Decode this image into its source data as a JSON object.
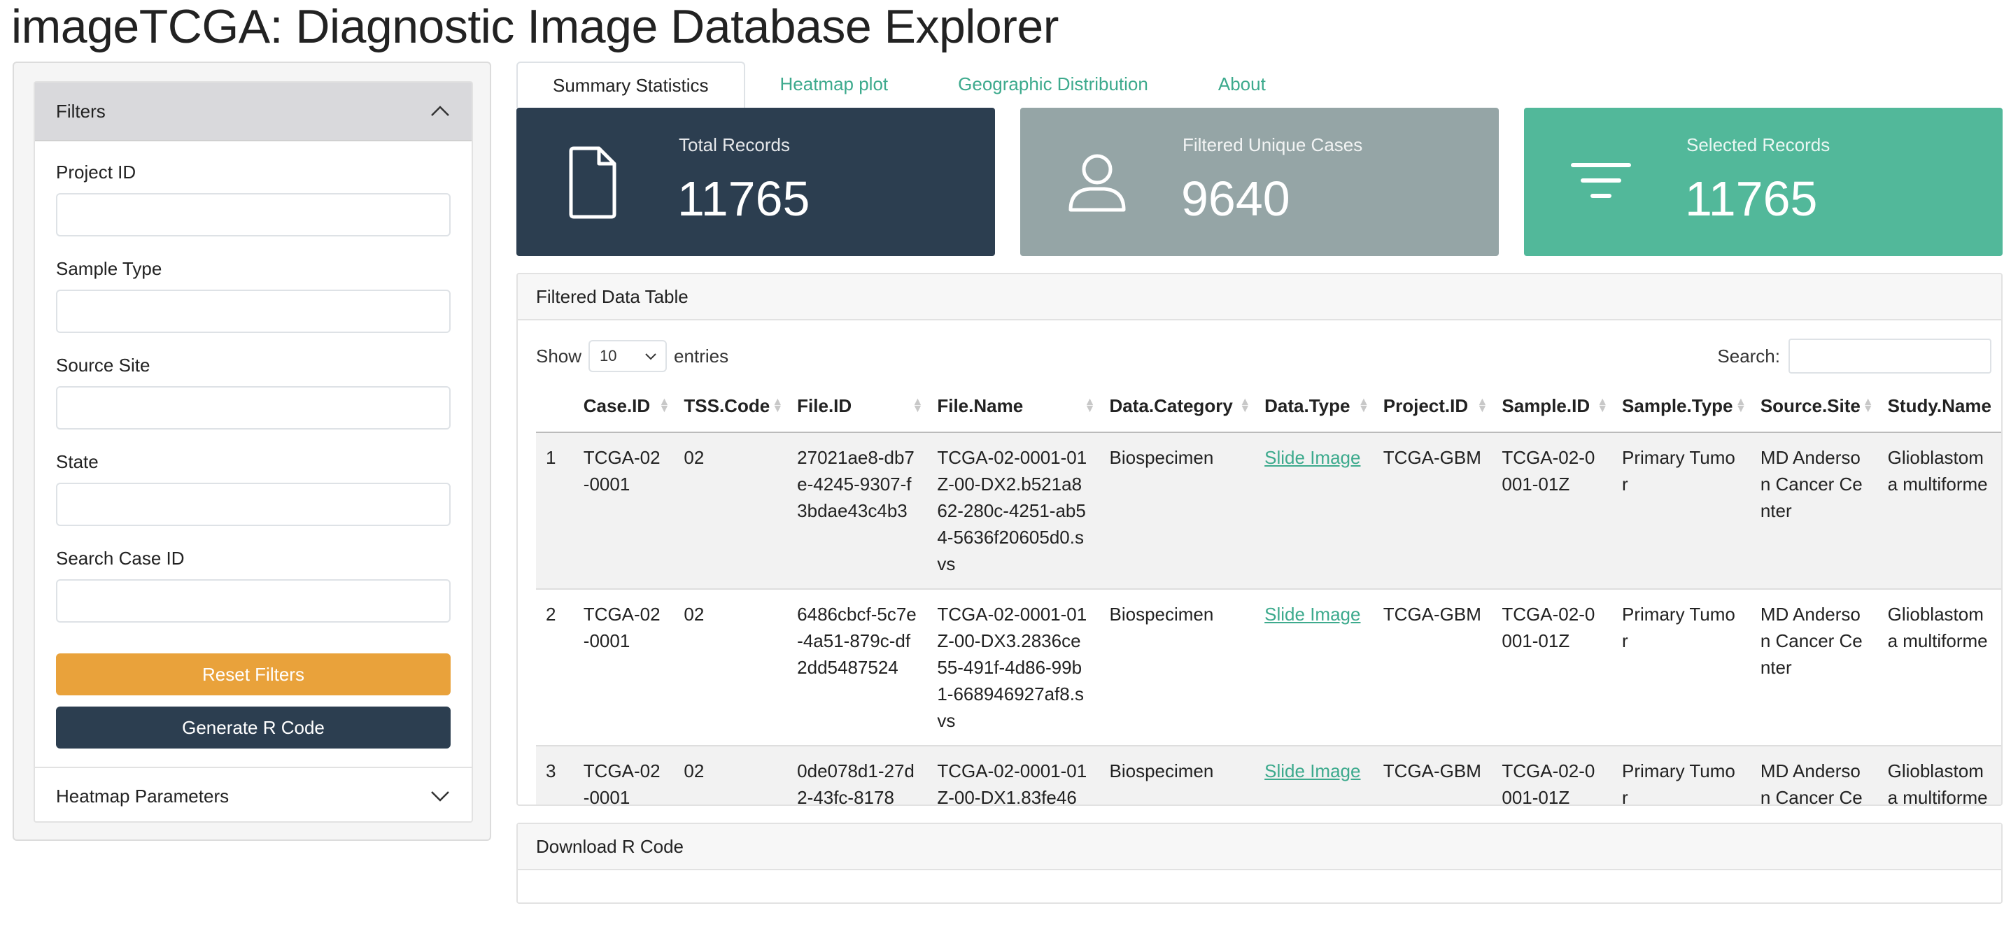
{
  "app": {
    "title": "imageTCGA: Diagnostic Image Database Explorer"
  },
  "sidebar": {
    "filters_header": "Filters",
    "fields": [
      {
        "label": "Project ID",
        "value": ""
      },
      {
        "label": "Sample Type",
        "value": ""
      },
      {
        "label": "Source Site",
        "value": ""
      },
      {
        "label": "State",
        "value": ""
      },
      {
        "label": "Search Case ID",
        "value": ""
      }
    ],
    "reset_label": "Reset Filters",
    "generate_label": "Generate R Code",
    "heatmap_header": "Heatmap Parameters"
  },
  "tabs": [
    {
      "label": "Summary Statistics",
      "active": true
    },
    {
      "label": "Heatmap plot",
      "active": false
    },
    {
      "label": "Geographic Distribution",
      "active": false
    },
    {
      "label": "About",
      "active": false
    }
  ],
  "value_boxes": [
    {
      "label": "Total Records",
      "value": "11765",
      "icon": "file-icon",
      "color": "#2c3e50"
    },
    {
      "label": "Filtered Unique Cases",
      "value": "9640",
      "icon": "user-icon",
      "color": "#95a5a6"
    },
    {
      "label": "Selected Records",
      "value": "11765",
      "icon": "filter-icon",
      "color": "#52b89a"
    }
  ],
  "table_card": {
    "header": "Filtered Data Table",
    "show_label": "Show",
    "entries_value": "10",
    "entries_label": "entries",
    "search_label": "Search:",
    "columns": [
      "",
      "Case.ID",
      "TSS.Code",
      "File.ID",
      "File.Name",
      "Data.Category",
      "Data.Type",
      "Project.ID",
      "Sample.ID",
      "Sample.Type",
      "Source.Site",
      "Study.Name"
    ],
    "rows": [
      [
        "1",
        "TCGA-02-0001",
        "02",
        "27021ae8-db7e-4245-9307-f3bdae43c4b3",
        "TCGA-02-0001-01Z-00-DX2.b521a862-280c-4251-ab54-5636f20605d0.svs",
        "Biospecimen",
        "Slide Image",
        "TCGA-GBM",
        "TCGA-02-0001-01Z",
        "Primary Tumor",
        "MD Anderson Cancer Center",
        "Glioblastoma multiforme"
      ],
      [
        "2",
        "TCGA-02-0001",
        "02",
        "6486cbcf-5c7e-4a51-879c-df2dd5487524",
        "TCGA-02-0001-01Z-00-DX3.2836ce55-491f-4d86-99b1-668946927af8.svs",
        "Biospecimen",
        "Slide Image",
        "TCGA-GBM",
        "TCGA-02-0001-01Z",
        "Primary Tumor",
        "MD Anderson Cancer Center",
        "Glioblastoma multiforme"
      ],
      [
        "3",
        "TCGA-02-0001",
        "02",
        "0de078d1-27d2-43fc-8178",
        "TCGA-02-0001-01Z-00-DX1.83fe46",
        "Biospecimen",
        "Slide Image",
        "TCGA-GBM",
        "TCGA-02-0001-01Z",
        "Primary Tumor",
        "MD Anderson Cancer Center",
        "Glioblastoma multiforme"
      ]
    ],
    "link_color": "#3daa8d"
  },
  "download_card": {
    "header": "Download R Code"
  }
}
